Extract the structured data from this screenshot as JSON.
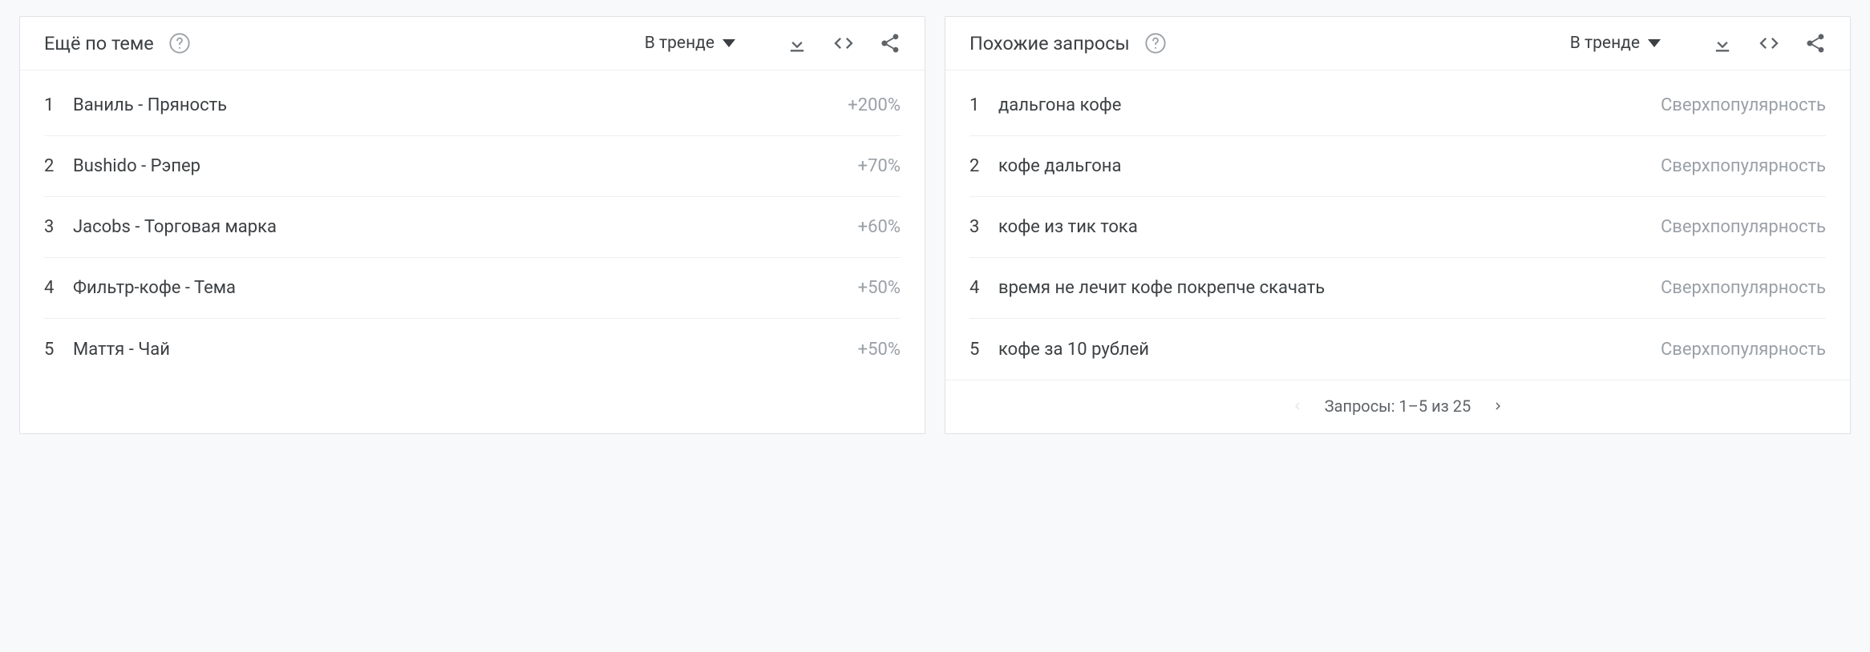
{
  "panels": {
    "topics": {
      "title": "Ещё по теме",
      "sort_label": "В тренде",
      "items": [
        {
          "rank": "1",
          "label": "Ваниль - Пряность",
          "value": "+200%"
        },
        {
          "rank": "2",
          "label": "Bushido - Рэпер",
          "value": "+70%"
        },
        {
          "rank": "3",
          "label": "Jacobs - Торговая марка",
          "value": "+60%"
        },
        {
          "rank": "4",
          "label": "Фильтр-кофе - Тема",
          "value": "+50%"
        },
        {
          "rank": "5",
          "label": "Маття - Чай",
          "value": "+50%"
        }
      ]
    },
    "queries": {
      "title": "Похожие запросы",
      "sort_label": "В тренде",
      "items": [
        {
          "rank": "1",
          "label": "дальгона кофе",
          "value": "Сверхпопулярность"
        },
        {
          "rank": "2",
          "label": "кофе дальгона",
          "value": "Сверхпопулярность"
        },
        {
          "rank": "3",
          "label": "кофе из тик тока",
          "value": "Сверхпопулярность"
        },
        {
          "rank": "4",
          "label": "время не лечит кофе покрепче скачать",
          "value": "Сверхпопулярность"
        },
        {
          "rank": "5",
          "label": "кофе за 10 рублей",
          "value": "Сверхпопулярность"
        }
      ],
      "pager": "Запросы: 1–5 из 25"
    }
  }
}
